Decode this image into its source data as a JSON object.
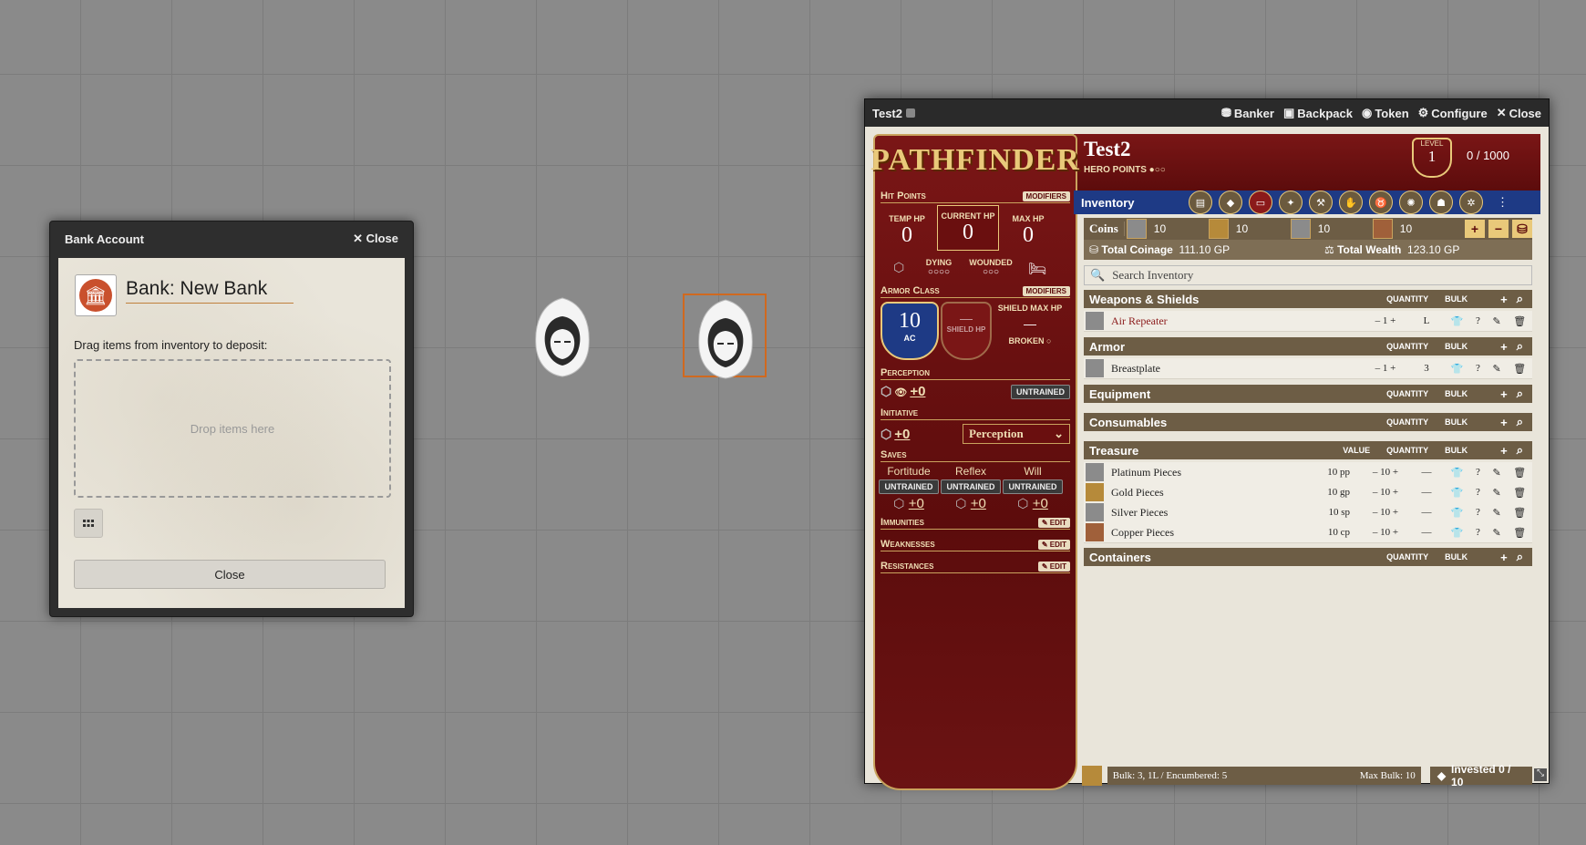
{
  "bank": {
    "title": "Bank Account",
    "close_label": "Close",
    "name": "Bank: New Bank",
    "instruction": "Drag items from inventory to deposit:",
    "drop_text": "Drop items here",
    "close_button": "Close"
  },
  "sheet": {
    "window_title": "Test2",
    "header_buttons": [
      "Banker",
      "Backpack",
      "Token",
      "Configure",
      "Close"
    ],
    "logo": "PATHFINDER",
    "char_name": "Test2",
    "hero_points": "HERO POINTS",
    "level_label": "LEVEL",
    "level": "1",
    "xp": "0 /  1000",
    "tab_name": "Inventory",
    "hp": {
      "title": "Hit Points",
      "modifiers": "MODIFIERS",
      "temp_label": "TEMP HP",
      "temp": "0",
      "current_label": "CURRENT HP",
      "current": "0",
      "max_label": "MAX HP",
      "max": "0",
      "dying": "DYING",
      "wounded": "WOUNDED"
    },
    "ac": {
      "title": "Armor Class",
      "modifiers": "MODIFIERS",
      "value": "10",
      "ac_label": "AC",
      "shield_label": "SHIELD HP",
      "shield_dash": "—",
      "shield_max_label": "SHIELD MAX HP",
      "shield_max": "—",
      "broken": "BROKEN"
    },
    "perception": {
      "title": "Perception",
      "value": "+0",
      "rank": "UNTRAINED"
    },
    "initiative": {
      "title": "Initiative",
      "value": "+0",
      "select": "Perception"
    },
    "saves": {
      "title": "Saves",
      "items": [
        {
          "name": "Fortitude",
          "rank": "UNTRAINED",
          "value": "+0"
        },
        {
          "name": "Reflex",
          "rank": "UNTRAINED",
          "value": "+0"
        },
        {
          "name": "Will",
          "rank": "UNTRAINED",
          "value": "+0"
        }
      ]
    },
    "immunities": "Immunities",
    "weaknesses": "Weaknesses",
    "resistances": "Resistances",
    "edit": "EDIT",
    "coins_label": "Coins",
    "coins": [
      "10",
      "10",
      "10",
      "10"
    ],
    "total_coinage_label": "Total Coinage",
    "total_coinage": "111.10 GP",
    "total_wealth_label": "Total Wealth",
    "total_wealth": "123.10 GP",
    "search_placeholder": "Search Inventory",
    "col_quantity": "QUANTITY",
    "col_bulk": "BULK",
    "col_value": "VALUE",
    "sections": {
      "weapons": {
        "title": "Weapons & Shields",
        "items": [
          {
            "name": "Air Repeater",
            "qty": "1",
            "bulk": "L"
          }
        ]
      },
      "armor": {
        "title": "Armor",
        "items": [
          {
            "name": "Breastplate",
            "qty": "1",
            "bulk": "3"
          }
        ]
      },
      "equipment": {
        "title": "Equipment"
      },
      "consumables": {
        "title": "Consumables"
      },
      "treasure": {
        "title": "Treasure",
        "items": [
          {
            "name": "Platinum Pieces",
            "value": "10 pp",
            "qty": "10",
            "bulk": "—"
          },
          {
            "name": "Gold Pieces",
            "value": "10 gp",
            "qty": "10",
            "bulk": "—"
          },
          {
            "name": "Silver Pieces",
            "value": "10 sp",
            "qty": "10",
            "bulk": "—"
          },
          {
            "name": "Copper Pieces",
            "value": "10 cp",
            "qty": "10",
            "bulk": "—"
          }
        ]
      },
      "containers": {
        "title": "Containers"
      }
    },
    "bulk_text": "Bulk: 3, 1L / Encumbered: 5",
    "max_bulk": "Max Bulk: 10",
    "invested": "Invested 0 / 10"
  }
}
